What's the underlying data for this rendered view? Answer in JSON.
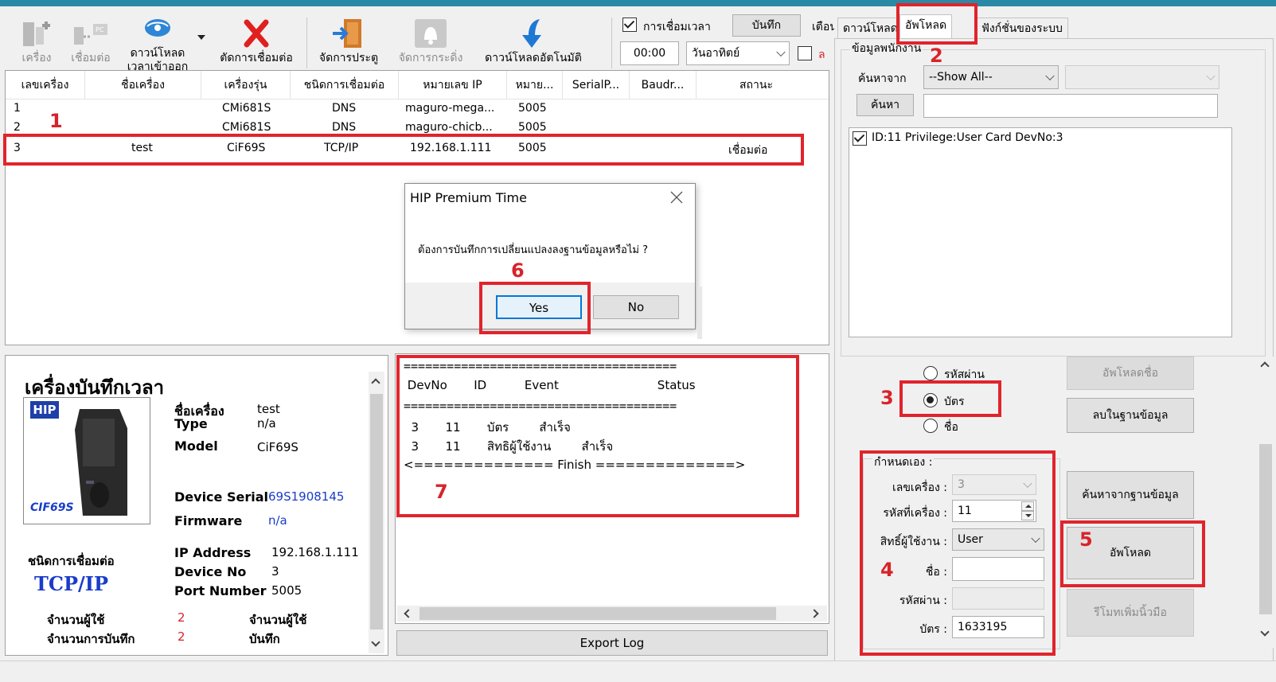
{
  "toolbar": {
    "buttons": [
      {
        "label1": "",
        "label2": "เครื่อง"
      },
      {
        "label1": "",
        "label2": "เชื่อมต่อ"
      },
      {
        "label1": "ดาวน์โหลด",
        "label2": "เวลาเข้าออก"
      },
      {
        "label1": "",
        "label2": "ตัดการเชื่อมต่อ"
      },
      {
        "label1": "",
        "label2": "จัดการประตู"
      },
      {
        "label1": "",
        "label2": "จัดการกระดิ่ง"
      },
      {
        "label1": "",
        "label2": "ดาวน์โหลดอัตโนมัติ"
      }
    ],
    "time_sync_label": "การเชื่อมเวลา",
    "save_button": "บันทึก",
    "warn_button": "เตือน",
    "time_value": "00:00",
    "day_value": "วันอาทิตย์",
    "trailing_text": "ล"
  },
  "device_table": {
    "headers": [
      "เลขเครื่อง",
      "ชื่อเครื่อง",
      "เครื่องรุ่น",
      "ชนิดการเชื่อมต่อ",
      "หมายเลข IP",
      "หมาย...",
      "SerialP...",
      "Baudr...",
      "สถานะ"
    ],
    "rows": [
      [
        "1",
        "",
        "CMi681S",
        "DNS",
        "maguro-mega...",
        "5005",
        "",
        "",
        ""
      ],
      [
        "2",
        "",
        "CMi681S",
        "DNS",
        "maguro-chicb...",
        "5005",
        "",
        "",
        ""
      ],
      [
        "3",
        "test",
        "CiF69S",
        "TCP/IP",
        "192.168.1.111",
        "5005",
        "",
        "",
        "เชื่อมต่อ"
      ]
    ]
  },
  "dialog": {
    "title": "HIP Premium Time",
    "message": "ต้องการบันทึกการเปลี่ยนแปลงลงฐานข้อมูลหรือไม่ ?",
    "yes": "Yes",
    "no": "No"
  },
  "device_info": {
    "heading": "เครื่องบันทึกเวลา",
    "brand": "HIP",
    "model_caption": "CIF69S",
    "labels": {
      "name": "ชื่อเครื่อง",
      "type": "Type",
      "model": "Model",
      "serial": "Device Serial",
      "firmware": "Firmware",
      "ip": "IP Address",
      "devno": "Device No",
      "port": "Port Number",
      "conn_type": "ชนิดการเชื่อมต่อ",
      "user_count": "จำนวนผู้ใช้",
      "record_count": "จำนวนการบันทึก",
      "user_count_r": "จำนวนผู้ใช้",
      "record_count_r": "บันทึก"
    },
    "values": {
      "name": "test",
      "type": "n/a",
      "model": "CiF69S",
      "serial": "69S1908145",
      "firmware": "n/a",
      "ip": "192.168.1.111",
      "devno": "3",
      "port": "5005",
      "conn_type": "TCP/IP",
      "user_count": "2",
      "record_count": "2"
    }
  },
  "log": {
    "sep": "======================================",
    "header": " DevNo       ID          Event                          Status",
    "line1": "  3       11       บัตร        สำเร็จ",
    "line2": "  3       11       สิทธิผู้ใช้งาน        สำเร็จ",
    "finish": "<============== Finish ==============>",
    "export_button": "Export Log"
  },
  "right_panel": {
    "tabs": [
      "ดาวน์โหลด",
      "อัพโหลด",
      "ฟังก์ชั่นของระบบ"
    ],
    "group_title": "ข้อมูลพนักงาน",
    "search_from_label": "ค้นหาจาก",
    "search_from_value": "--Show All--",
    "search_button": "ค้นหา",
    "search_value": "",
    "list_items": [
      "ID:11 Privilege:User Card DevNo:3"
    ],
    "radio_options": [
      "รหัสผ่าน",
      "บัตร",
      "ชื่อ"
    ],
    "upload_name_button": "อัพโหลดชื่อ",
    "delete_db_button": "ลบในฐานข้อมูล",
    "custom_group_title": "กำหนดเอง :",
    "custom_labels": {
      "devno": "เลขเครื่อง :",
      "devcode": "รหัสที่เครื่อง :",
      "privilege": "สิทธิ์ผู้ใช้งาน :",
      "name": "ชื่อ :",
      "password": "รหัสผ่าน :",
      "card": "บัตร :"
    },
    "custom_values": {
      "devno": "3",
      "devcode": "11",
      "privilege": "User",
      "name": "",
      "password": "",
      "card": "1633195"
    },
    "search_db_button": "ค้นหาจากฐานข้อมูล",
    "upload_button": "อัพโหลด",
    "remote_button": "รีโมทเพิ่มนิ้วมือ"
  },
  "annotations": [
    "1",
    "2",
    "3",
    "4",
    "5",
    "6",
    "7"
  ],
  "colors": {
    "annotation_red": "#e0242c",
    "link_blue": "#1a3cc8",
    "value_red": "#d8232a"
  }
}
